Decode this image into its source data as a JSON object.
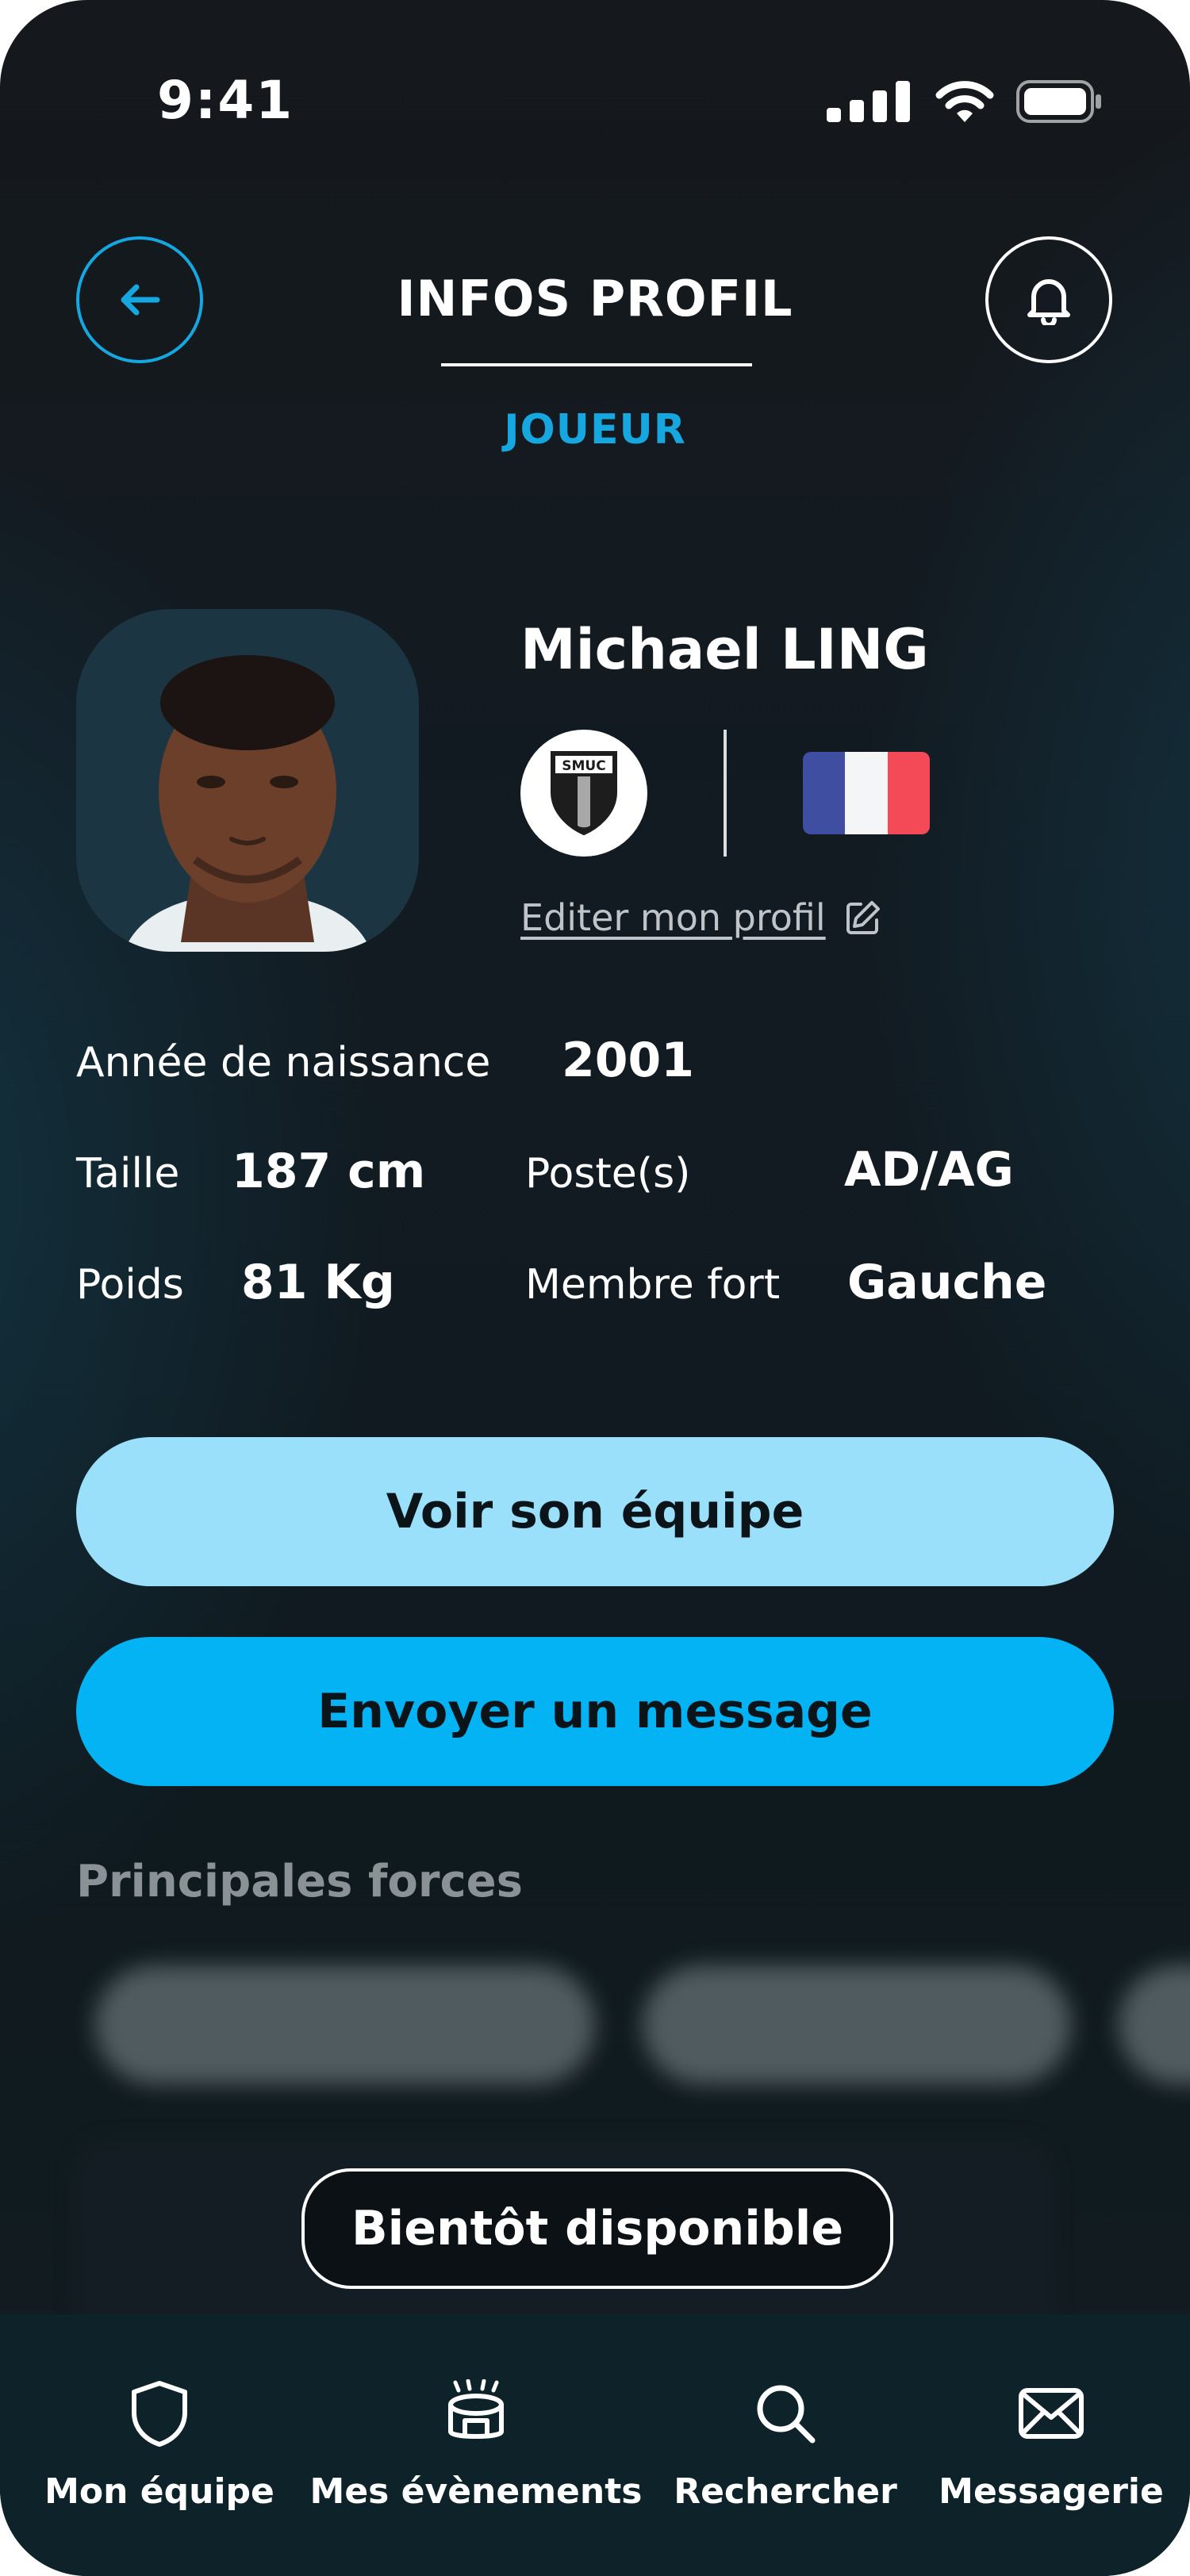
{
  "status_bar": {
    "time": "9:41"
  },
  "header": {
    "back_icon": "arrow-left-icon",
    "title": "INFOS PROFIL",
    "notification_icon": "bell-icon",
    "tab": "JOUEUR"
  },
  "profile": {
    "name": "Michael LING",
    "club_badge_text": "SMUC",
    "flag": "france",
    "flag_colors": [
      "#3f4ea0",
      "#f4f5f7",
      "#f44a58"
    ],
    "edit_link": "Editer mon profil",
    "edit_icon": "pencil-square-icon"
  },
  "info": {
    "birth_year_label": "Année de naissance",
    "birth_year": "2001",
    "height_label": "Taille",
    "height": "187 cm",
    "position_label": "Poste(s)",
    "position": "AD/AG",
    "weight_label": "Poids",
    "weight": "81 Kg",
    "strong_side_label": "Membre fort",
    "strong_side": "Gauche"
  },
  "actions": {
    "team_button": "Voir son équipe",
    "message_button": "Envoyer un message"
  },
  "strengths": {
    "title": "Principales forces",
    "coming_soon": "Bientôt disponible"
  },
  "bottom_nav": {
    "items": [
      {
        "label": "Mon équipe",
        "icon": "shield-icon"
      },
      {
        "label": "Mes évènements",
        "icon": "stadium-icon"
      },
      {
        "label": "Rechercher",
        "icon": "search-icon"
      },
      {
        "label": "Messagerie",
        "icon": "mail-icon"
      }
    ]
  },
  "colors": {
    "accent": "#16a7e0",
    "team_button_bg": "#9be0fa",
    "message_button_bg": "#04b3f4",
    "background": "#131a20",
    "nav_background": "#0d2229"
  }
}
